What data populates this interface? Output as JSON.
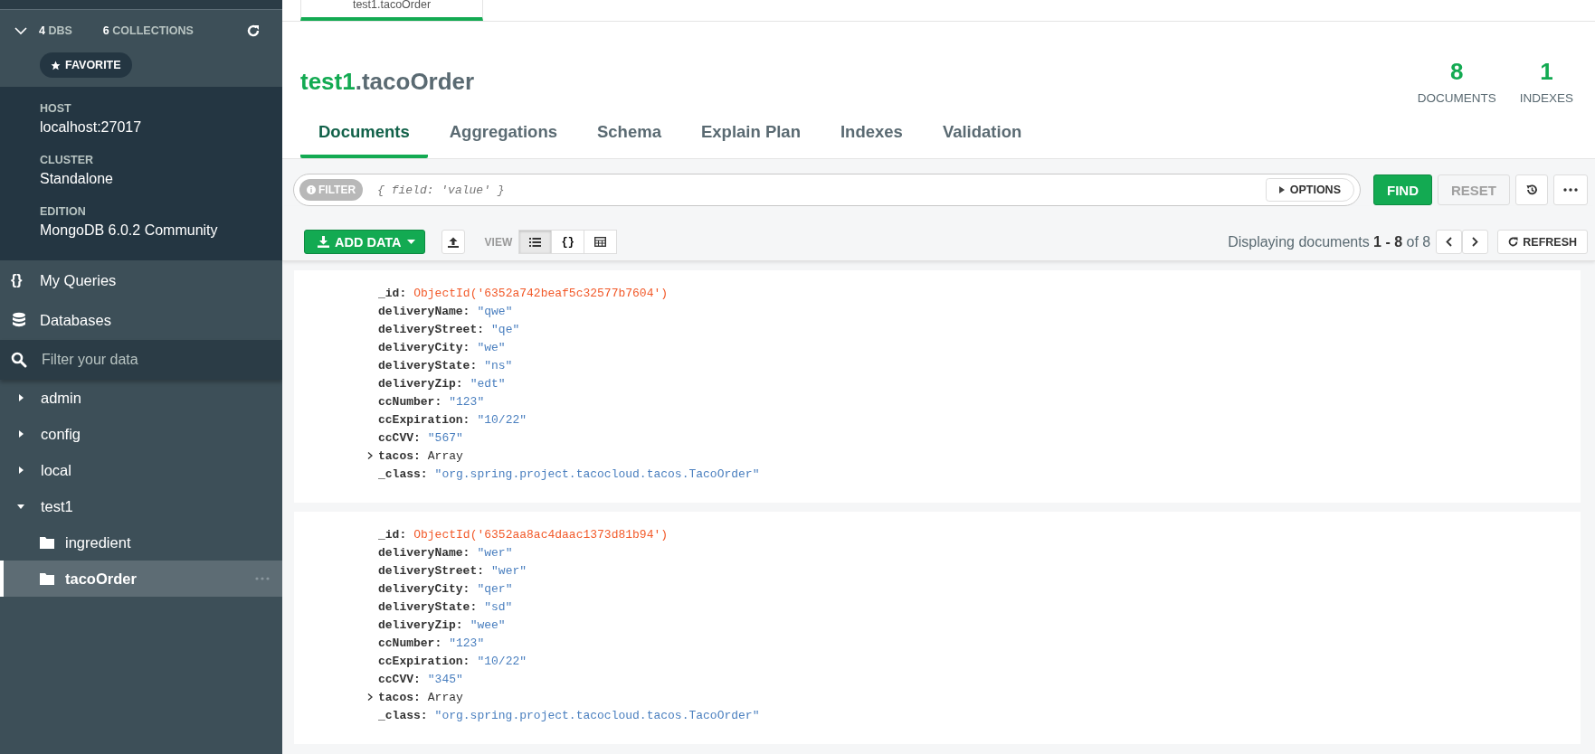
{
  "connection": {
    "expanded": true,
    "dbs_count": "4",
    "dbs_label": "DBS",
    "collections_count": "6",
    "collections_label": "COLLECTIONS",
    "favorite_button": "FAVORITE",
    "details": [
      {
        "label": "HOST",
        "value": "localhost:27017"
      },
      {
        "label": "CLUSTER",
        "value": "Standalone"
      },
      {
        "label": "EDITION",
        "value": "MongoDB 6.0.2 Community"
      }
    ]
  },
  "sidebar": {
    "nav": [
      {
        "kind": "queries",
        "glyph": "{}",
        "label": "My Queries"
      },
      {
        "kind": "databases",
        "label": "Databases"
      }
    ],
    "filter": {
      "placeholder": "Filter your data"
    },
    "tree": [
      {
        "label": "admin",
        "expanded": false
      },
      {
        "label": "config",
        "expanded": false
      },
      {
        "label": "local",
        "expanded": false
      },
      {
        "label": "test1",
        "expanded": true,
        "children": [
          {
            "label": "ingredient",
            "selected": false
          },
          {
            "label": "tacoOrder",
            "selected": true
          }
        ]
      }
    ]
  },
  "top_tabs": [
    {
      "label": "test1.tacoOrder",
      "selected": true
    }
  ],
  "header": {
    "database": "test1",
    "collection": ".tacoOrder",
    "stats": [
      {
        "value": "8",
        "label": "DOCUMENTS"
      },
      {
        "value": "1",
        "label": "INDEXES"
      }
    ]
  },
  "tabs": [
    {
      "label": "Documents",
      "selected": true
    },
    {
      "label": "Aggregations",
      "selected": false
    },
    {
      "label": "Schema",
      "selected": false
    },
    {
      "label": "Explain Plan",
      "selected": false
    },
    {
      "label": "Indexes",
      "selected": false
    },
    {
      "label": "Validation",
      "selected": false
    }
  ],
  "query_bar": {
    "filter_badge": "FILTER",
    "placeholder": "{ field: 'value' }",
    "options_button": "OPTIONS",
    "find_button": "FIND",
    "reset_button": "RESET"
  },
  "toolbar": {
    "add_data_button": "ADD DATA",
    "view_label": "VIEW",
    "views": [
      {
        "kind": "list",
        "selected": true
      },
      {
        "kind": "json",
        "glyph": "{}",
        "selected": false
      },
      {
        "kind": "table",
        "selected": false
      }
    ],
    "pagination": "Displaying documents **1 - 8** of 8",
    "refresh_button": "REFRESH"
  },
  "documents": [
    {
      "fields": [
        {
          "key": "_id:",
          "kind": "objectid",
          "value": "ObjectId('6352a742beaf5c32577b7604')"
        },
        {
          "key": "deliveryName:",
          "kind": "string",
          "value": "\"qwe\""
        },
        {
          "key": "deliveryStreet:",
          "kind": "string",
          "value": "\"qe\""
        },
        {
          "key": "deliveryCity:",
          "kind": "string",
          "value": "\"we\""
        },
        {
          "key": "deliveryState:",
          "kind": "string",
          "value": "\"ns\""
        },
        {
          "key": "deliveryZip:",
          "kind": "string",
          "value": "\"edt\""
        },
        {
          "key": "ccNumber:",
          "kind": "string",
          "value": "\"123\""
        },
        {
          "key": "ccExpiration:",
          "kind": "string",
          "value": "\"10/22\""
        },
        {
          "key": "ccCVV:",
          "kind": "string",
          "value": "\"567\""
        },
        {
          "key": "tacos:",
          "kind": "array",
          "value": "Array",
          "expanded": false
        },
        {
          "key": "_class:",
          "kind": "string",
          "value": "\"org.spring.project.tacocloud.tacos.TacoOrder\""
        }
      ]
    },
    {
      "fields": [
        {
          "key": "_id:",
          "kind": "objectid",
          "value": "ObjectId('6352aa8ac4daac1373d81b94')"
        },
        {
          "key": "deliveryName:",
          "kind": "string",
          "value": "\"wer\""
        },
        {
          "key": "deliveryStreet:",
          "kind": "string",
          "value": "\"wer\""
        },
        {
          "key": "deliveryCity:",
          "kind": "string",
          "value": "\"qer\""
        },
        {
          "key": "deliveryState:",
          "kind": "string",
          "value": "\"sd\""
        },
        {
          "key": "deliveryZip:",
          "kind": "string",
          "value": "\"wee\""
        },
        {
          "key": "ccNumber:",
          "kind": "string",
          "value": "\"123\""
        },
        {
          "key": "ccExpiration:",
          "kind": "string",
          "value": "\"10/22\""
        },
        {
          "key": "ccCVV:",
          "kind": "string",
          "value": "\"345\""
        },
        {
          "key": "tacos:",
          "kind": "array",
          "value": "Array",
          "expanded": false
        },
        {
          "key": "_class:",
          "kind": "string",
          "value": "\"org.spring.project.tacocloud.tacos.TacoOrder\""
        }
      ]
    }
  ]
}
